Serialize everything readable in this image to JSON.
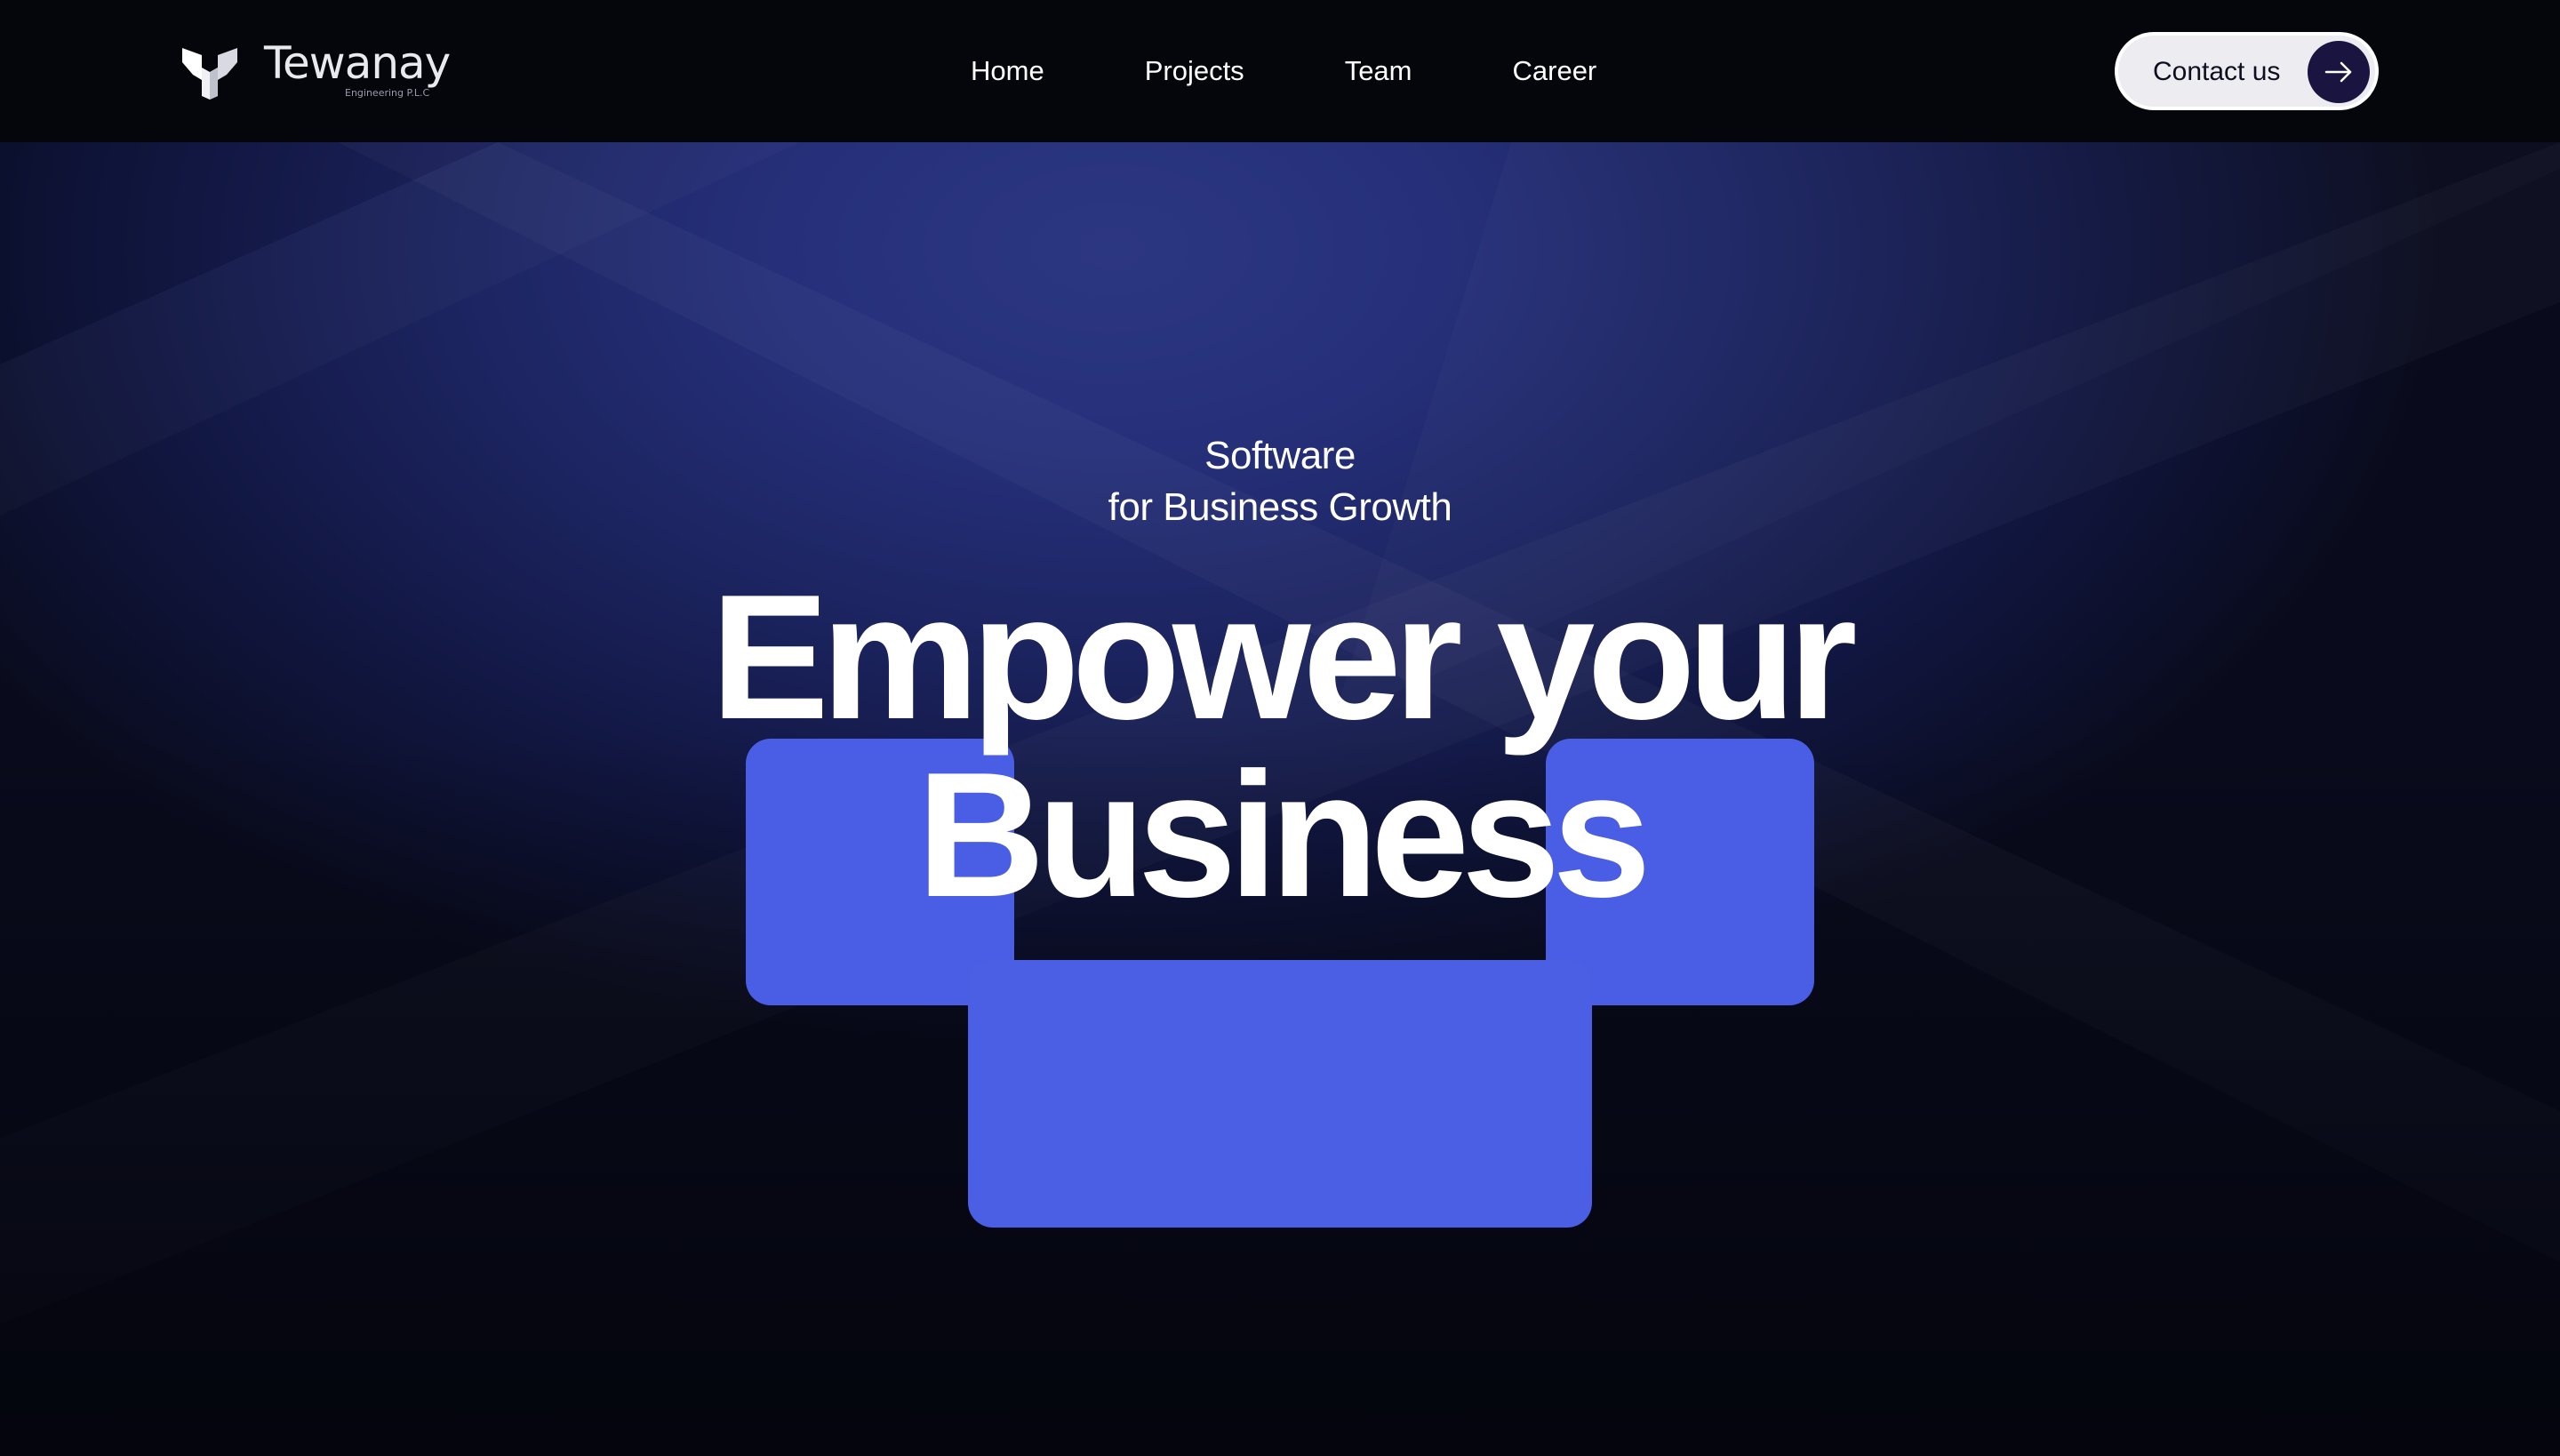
{
  "brand": {
    "name": "Tewanay",
    "subtitle": "Engineering P.L.C"
  },
  "nav": {
    "items": [
      {
        "label": "Home"
      },
      {
        "label": "Projects"
      },
      {
        "label": "Team"
      },
      {
        "label": "Career"
      }
    ],
    "cta_label": "Contact us",
    "cta_icon": "arrow-right-icon"
  },
  "hero": {
    "tagline_line1": "Software",
    "tagline_line2": "for Business Growth",
    "headline_line1": "Empower your",
    "headline_line2": "Business"
  },
  "colors": {
    "nav_background": "#05060b",
    "hero_glow": "#2c3782",
    "accent_blue": "#4a5ee5",
    "cta_background": "#ececf1",
    "cta_icon_background": "#1a1440"
  }
}
